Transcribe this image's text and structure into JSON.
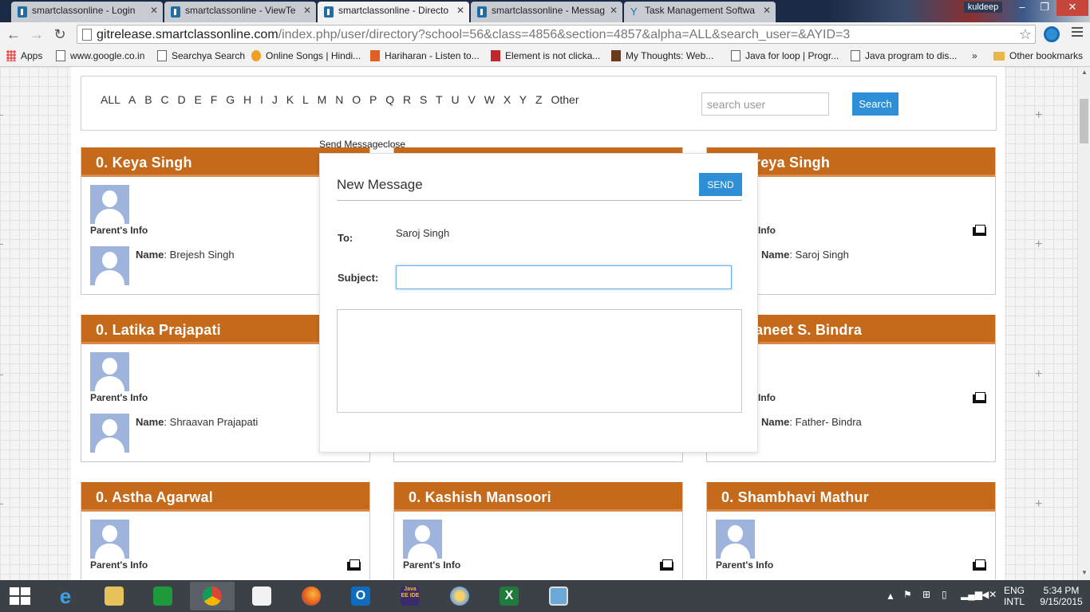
{
  "browser": {
    "tabs": [
      {
        "label": "smartclassonline - Login",
        "icon": "smartclass-favicon"
      },
      {
        "label": "smartclassonline - ViewTe",
        "icon": "smartclass-favicon"
      },
      {
        "label": "smartclassonline - Directo",
        "icon": "smartclass-favicon",
        "active": true
      },
      {
        "label": "smartclassonline - Messag",
        "icon": "smartclass-favicon"
      },
      {
        "label": "Task Management Softwa",
        "icon": "task-management-favicon"
      }
    ],
    "profile_name": "kuldeep",
    "url_host": "gitrelease.smartclassonline.com",
    "url_path": "/index.php/user/directory?school=56&class=4856&section=4857&alpha=ALL&search_user=&AYID=3",
    "bookmarks": [
      {
        "label": "Apps",
        "icon": "apps-grid-icon"
      },
      {
        "label": "www.google.co.in",
        "icon": "page-icon"
      },
      {
        "label": "Searchya Search",
        "icon": "page-icon"
      },
      {
        "label": "Online Songs | Hindi...",
        "icon": "songs-icon"
      },
      {
        "label": "Hariharan - Listen to...",
        "icon": "music-icon"
      },
      {
        "label": "Element is not clicka...",
        "icon": "stackoverflow-icon"
      },
      {
        "label": "My Thoughts: Web...",
        "icon": "blog-icon"
      },
      {
        "label": "Java for loop | Progr...",
        "icon": "page-icon"
      },
      {
        "label": "Java program to dis...",
        "icon": "page-icon"
      }
    ],
    "bookmarks_overflow": "»",
    "other_bookmarks": "Other bookmarks"
  },
  "filter": {
    "letters": [
      "ALL",
      "A",
      "B",
      "C",
      "D",
      "E",
      "F",
      "G",
      "H",
      "I",
      "J",
      "K",
      "L",
      "M",
      "N",
      "O",
      "P",
      "Q",
      "R",
      "S",
      "T",
      "U",
      "V",
      "W",
      "X",
      "Y",
      "Z",
      "Other"
    ],
    "search_placeholder": "search user",
    "search_button": "Search"
  },
  "cards": [
    {
      "title": "0. Keya Singh",
      "parent_label": "Parent's Info",
      "name_label": "Name",
      "parent_name": "Brejesh Singh"
    },
    {
      "title": "reya Singh",
      "parent_label": "Info",
      "name_label": "Name",
      "parent_name": "Saroj Singh"
    },
    {
      "title": "0. Latika Prajapati",
      "parent_label": "Parent's Info",
      "name_label": "Name",
      "parent_name": "Shraavan Prajapati"
    },
    {
      "title": "aneet S. Bindra",
      "parent_label": "Info",
      "name_label": "Name",
      "parent_name": "Father- Bindra"
    },
    {
      "title": "0. Astha Agarwal",
      "parent_label": "Parent's Info"
    },
    {
      "title": "0. Kashish Mansoori",
      "parent_label": "Parent's Info"
    },
    {
      "title": "0. Shambhavi Mathur",
      "parent_label": "Parent's Info"
    }
  ],
  "modal": {
    "caption": "Send Messageclose",
    "title": "New Message",
    "send_label": "SEND",
    "to_label": "To:",
    "to_value": "Saroj Singh",
    "subject_label": "Subject:",
    "subject_value": "",
    "body_value": ""
  },
  "taskbar": {
    "apps": [
      {
        "name": "internet-explorer",
        "glyph": "e"
      },
      {
        "name": "file-explorer",
        "glyph": ""
      },
      {
        "name": "windows-store",
        "glyph": ""
      },
      {
        "name": "google-chrome",
        "glyph": "",
        "active": true
      },
      {
        "name": "apps-launcher",
        "glyph": ""
      },
      {
        "name": "firefox",
        "glyph": ""
      },
      {
        "name": "outlook",
        "glyph": "O"
      },
      {
        "name": "java-ee-ide",
        "glyph": "Java EE IDE"
      },
      {
        "name": "paint",
        "glyph": ""
      },
      {
        "name": "excel",
        "glyph": "X"
      },
      {
        "name": "remote-desktop",
        "glyph": ""
      }
    ],
    "language_top": "ENG",
    "language_bottom": "INTL",
    "time": "5:34 PM",
    "date": "9/15/2015"
  },
  "colors": {
    "card_header": "#c56a1a",
    "button_blue": "#2f8fd6",
    "taskbar": "#3c4147"
  }
}
